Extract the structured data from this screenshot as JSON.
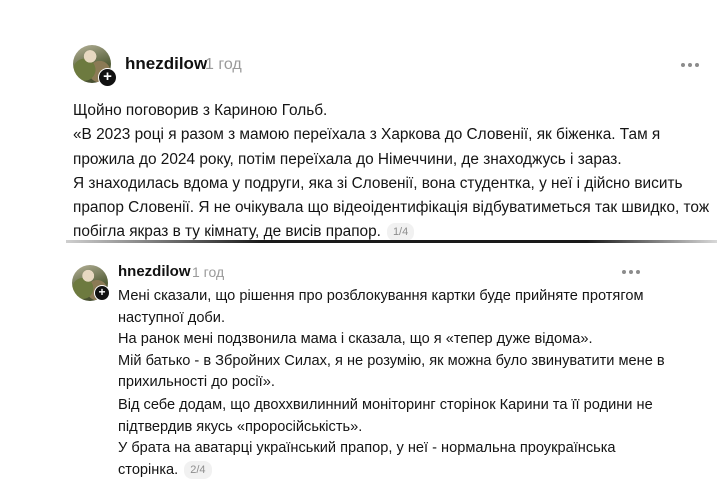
{
  "posts": [
    {
      "username": "hnezdilow",
      "time": "1 год",
      "body": "Щойно поговорив з Кариною Гольб.\n«В 2023 році я разом з мамою переїхала з Харкова до Словенії, як біженка. Там я прожила до 2024 року, потім переїхала до Німеччини, де знаходжусь і зараз.\nЯ знаходилась вдома у подруги, яка зі Словенії, вона студентка, у неї і дійсно висить прапор Словенії. Я не очікувала що відеоідентифікація відбуватиметься так швидко, тож побігла якраз в ту кімнату, де висів прапор.",
      "pager": "1/4"
    },
    {
      "username": "hnezdilow",
      "time": "1 год",
      "body_part1": "Мені сказали, що рішення про розблокування картки буде прийняте протягом наступної доби.\nНа ранок мені подзвонила мама і сказала, що я «тепер дуже відома».\nМій батько - в Збройних Силах, я не розумію, як можна було звинуватити мене в прихильності до росії».",
      "body_part2": "Від себе додам, що двоххвилинний моніторинг сторінок Карини та її родини не підтвердив якусь «проросійськість».\nУ брата на аватарці український прапор, у неї - нормальна проукраїнська сторінка.",
      "pager": "2/4"
    }
  ],
  "icons": {
    "avatar_badge": "plus-icon",
    "menu": "more-dots-icon"
  }
}
